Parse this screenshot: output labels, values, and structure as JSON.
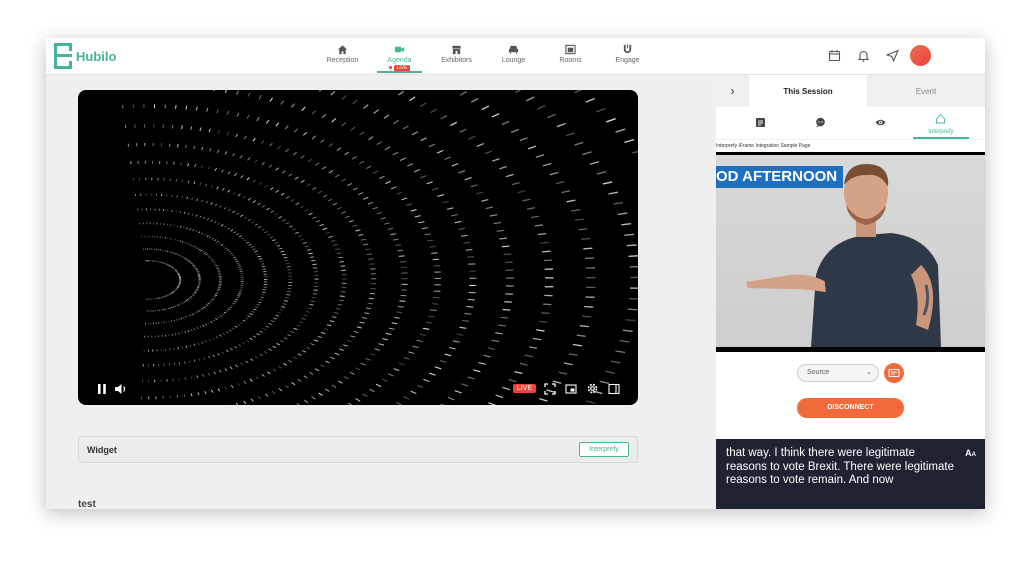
{
  "brand": {
    "name": "Hubilo",
    "color": "#44b59a"
  },
  "nav": {
    "items": [
      {
        "label": "Reception",
        "icon": "home-icon"
      },
      {
        "label": "Agenda",
        "icon": "video-icon",
        "active": true,
        "badge": "LIVE"
      },
      {
        "label": "Exhibitors",
        "icon": "store-icon"
      },
      {
        "label": "Lounge",
        "icon": "sofa-icon"
      },
      {
        "label": "Rooms",
        "icon": "rooms-icon"
      },
      {
        "label": "Engage",
        "icon": "magnet-icon"
      }
    ]
  },
  "header_icons": [
    "calendar-icon",
    "bell-icon",
    "send-icon"
  ],
  "player": {
    "live_label": "LIVE",
    "controls": [
      "pause-icon",
      "volume-icon",
      "fullscreen-icon",
      "pip-icon",
      "settings-icon",
      "theater-icon"
    ]
  },
  "widget": {
    "title": "Widget",
    "button_label": "Interprefy"
  },
  "main_footer_text": "test",
  "panel": {
    "tabs": [
      {
        "label": "This Session",
        "active": true
      },
      {
        "label": "Event"
      }
    ],
    "subtabs": [
      {
        "icon": "notes-icon"
      },
      {
        "icon": "chat-icon"
      },
      {
        "icon": "eye-icon"
      },
      {
        "icon": "interprefy-icon",
        "label": "Interprefy",
        "active": true
      }
    ],
    "iframe_caption": "Interprefy iFrame Integration Sample Page",
    "video_banner": "OD AFTERNOON",
    "source_select": "Source",
    "disconnect_label": "DISCONNECT",
    "caption_text": "that way. I think there were legitimate reasons to vote Brexit. There were legitimate reasons to vote remain. And now",
    "font_toggle_label": "A"
  },
  "colors": {
    "accent": "#44b59a",
    "live": "#e8453c",
    "orange": "#f26a3a",
    "caption_bg": "#1f2230"
  }
}
